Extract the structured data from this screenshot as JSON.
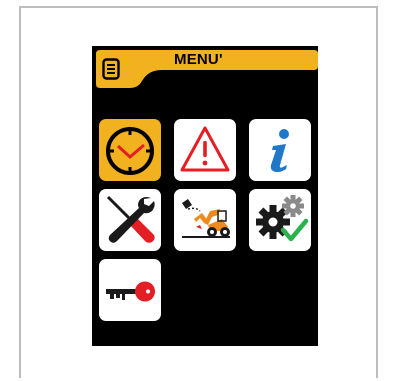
{
  "header": {
    "title": "MENU'",
    "menu_icon": "hamburger-icon"
  },
  "colors": {
    "accent": "#f2b220",
    "background": "#000000",
    "tile": "#ffffff",
    "warning": "#e31e24",
    "info": "#1f78c8",
    "check": "#2bb24c"
  },
  "tiles": [
    {
      "icon": "clock-icon",
      "selected": true
    },
    {
      "icon": "warning-icon",
      "selected": false
    },
    {
      "icon": "info-icon",
      "selected": false
    },
    {
      "icon": "tools-icon",
      "selected": false
    },
    {
      "icon": "machine-icon",
      "selected": false
    },
    {
      "icon": "settings-gears-icon",
      "selected": false
    },
    {
      "icon": "key-icon",
      "selected": false
    }
  ]
}
